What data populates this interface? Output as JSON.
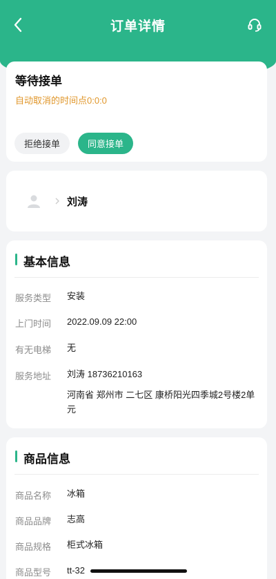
{
  "header": {
    "title": "订单详情"
  },
  "icons": {
    "back": "chevron-left-icon",
    "support": "headset-icon",
    "avatar": "user-avatar-icon"
  },
  "colors": {
    "brand": "#2bb58a",
    "warning": "#e0962a"
  },
  "status": {
    "title": "等待接单",
    "auto_cancel": "自动取消的时间点0:0:0",
    "reject_label": "拒绝接单",
    "accept_label": "同意接单"
  },
  "customer": {
    "name": "刘涛"
  },
  "basic_info": {
    "title": "基本信息",
    "rows": [
      {
        "label": "服务类型",
        "value": "安装"
      },
      {
        "label": "上门时间",
        "value": "2022.09.09 22:00"
      },
      {
        "label": "有无电梯",
        "value": "无"
      },
      {
        "label": "服务地址",
        "value": "刘涛 18736210163",
        "value2": "河南省 郑州市 二七区 康桥阳光四季城2号楼2单元"
      }
    ]
  },
  "goods_info": {
    "title": "商品信息",
    "rows": [
      {
        "label": "商品名称",
        "value": "冰箱"
      },
      {
        "label": "商品品牌",
        "value": "志高"
      },
      {
        "label": "商品规格",
        "value": "柜式冰箱"
      },
      {
        "label": "商品型号",
        "value": "tt-32"
      }
    ]
  }
}
